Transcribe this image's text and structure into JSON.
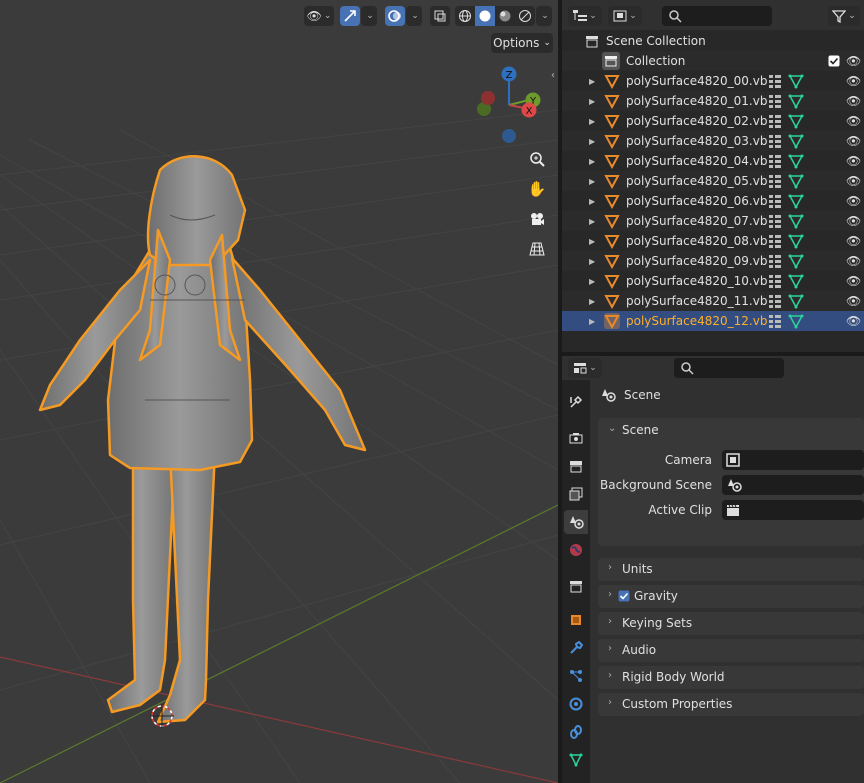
{
  "viewport": {
    "options_label": "Options",
    "header_icons": [
      "visibility-icon",
      "gizmo-icon",
      "overlay-icon",
      "xray-icon",
      "wireframe-shading-icon",
      "solid-shading-icon",
      "material-shading-icon",
      "rendered-shading-icon"
    ],
    "gizmo": {
      "z_label": "Z",
      "y_label": "Y",
      "x_label": "X"
    },
    "colors": {
      "selection_outline": "#f5a623",
      "x_axis": "#c14343",
      "y_axis": "#6e9a2c",
      "background": "#3b3b3b"
    }
  },
  "outliner": {
    "search_placeholder": "",
    "scene_collection": "Scene Collection",
    "collection": "Collection",
    "objects": [
      {
        "name": "polySurface4820_00.vb",
        "selected": false
      },
      {
        "name": "polySurface4820_01.vb",
        "selected": false
      },
      {
        "name": "polySurface4820_02.vb",
        "selected": false
      },
      {
        "name": "polySurface4820_03.vb",
        "selected": false
      },
      {
        "name": "polySurface4820_04.vb",
        "selected": false
      },
      {
        "name": "polySurface4820_05.vb",
        "selected": false
      },
      {
        "name": "polySurface4820_06.vb",
        "selected": false
      },
      {
        "name": "polySurface4820_07.vb",
        "selected": false
      },
      {
        "name": "polySurface4820_08.vb",
        "selected": false
      },
      {
        "name": "polySurface4820_09.vb",
        "selected": false
      },
      {
        "name": "polySurface4820_10.vb",
        "selected": false
      },
      {
        "name": "polySurface4820_11.vb",
        "selected": false
      },
      {
        "name": "polySurface4820_12.vb",
        "selected": true
      }
    ]
  },
  "properties": {
    "search_placeholder": "",
    "context_title": "Scene",
    "scene_panel": {
      "title": "Scene",
      "camera_label": "Camera",
      "background_scene_label": "Background Scene",
      "active_clip_label": "Active Clip"
    },
    "collapsed_panels": [
      {
        "title": "Units",
        "checkbox": false
      },
      {
        "title": "Gravity",
        "checkbox": true
      },
      {
        "title": "Keying Sets",
        "checkbox": false
      },
      {
        "title": "Audio",
        "checkbox": false
      },
      {
        "title": "Rigid Body World",
        "checkbox": false
      },
      {
        "title": "Custom Properties",
        "checkbox": false
      }
    ],
    "tabs": [
      "tool-icon",
      "render-icon",
      "output-icon",
      "view-layer-icon",
      "scene-icon",
      "world-icon",
      "collection-icon",
      "object-icon",
      "modifier-icon",
      "particles-icon",
      "physics-icon",
      "constraints-icon",
      "data-icon"
    ],
    "active_tab": "scene-icon"
  }
}
